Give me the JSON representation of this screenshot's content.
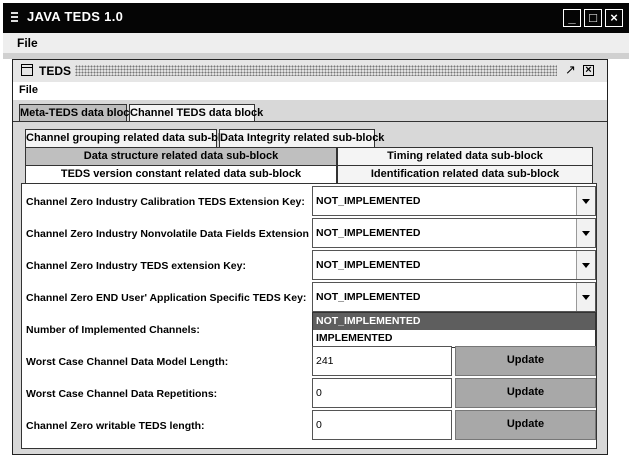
{
  "app": {
    "title": "JAVA TEDS 1.0",
    "menu": [
      "File"
    ],
    "window_buttons": [
      "minimize-icon",
      "maximize-icon",
      "close-icon"
    ]
  },
  "internal_frame": {
    "title": "TEDS",
    "menu": [
      "File"
    ]
  },
  "main_tabs": [
    {
      "label": "Meta-TEDS data block",
      "selected": true
    },
    {
      "label": "Channel TEDS data block",
      "selected": false
    }
  ],
  "sub_tabs": {
    "row1": [
      "Channel grouping related data sub-block",
      "Data Integrity related sub-block"
    ],
    "row2": [
      "Data structure related data sub-block",
      "Timing related data sub-block"
    ],
    "row3": [
      "TEDS version constant related data sub-block",
      "Identification related data sub-block"
    ]
  },
  "form": {
    "combos": [
      {
        "label": "Channel Zero Industry Calibration TEDS Extension Key:",
        "value": "NOT_IMPLEMENTED"
      },
      {
        "label": "Channel Zero Industry Nonvolatile Data Fields Extension Key:",
        "value": "NOT_IMPLEMENTED"
      },
      {
        "label": "Channel Zero Industry TEDS extension Key:",
        "value": "NOT_IMPLEMENTED"
      },
      {
        "label": "Channel Zero END User' Application Specific TEDS Key:",
        "value": "NOT_IMPLEMENTED"
      }
    ],
    "dropdown_options": [
      {
        "label": "NOT_IMPLEMENTED",
        "highlighted": true
      },
      {
        "label": "IMPLEMENTED",
        "highlighted": false
      }
    ],
    "channels_label": "Number of Implemented Channels:",
    "fields": [
      {
        "label": "Worst Case Channel Data Model Length:",
        "value": "241",
        "button": "Update"
      },
      {
        "label": "Worst Case Channel Data Repetitions:",
        "value": "0",
        "button": "Update"
      },
      {
        "label": "Channel Zero writable TEDS length:",
        "value": "0",
        "button": "Update"
      }
    ]
  },
  "colors": {
    "title_bar": "#050505",
    "selected_highlight": "#5e5e5e",
    "update_button": "#a8a8a8"
  }
}
